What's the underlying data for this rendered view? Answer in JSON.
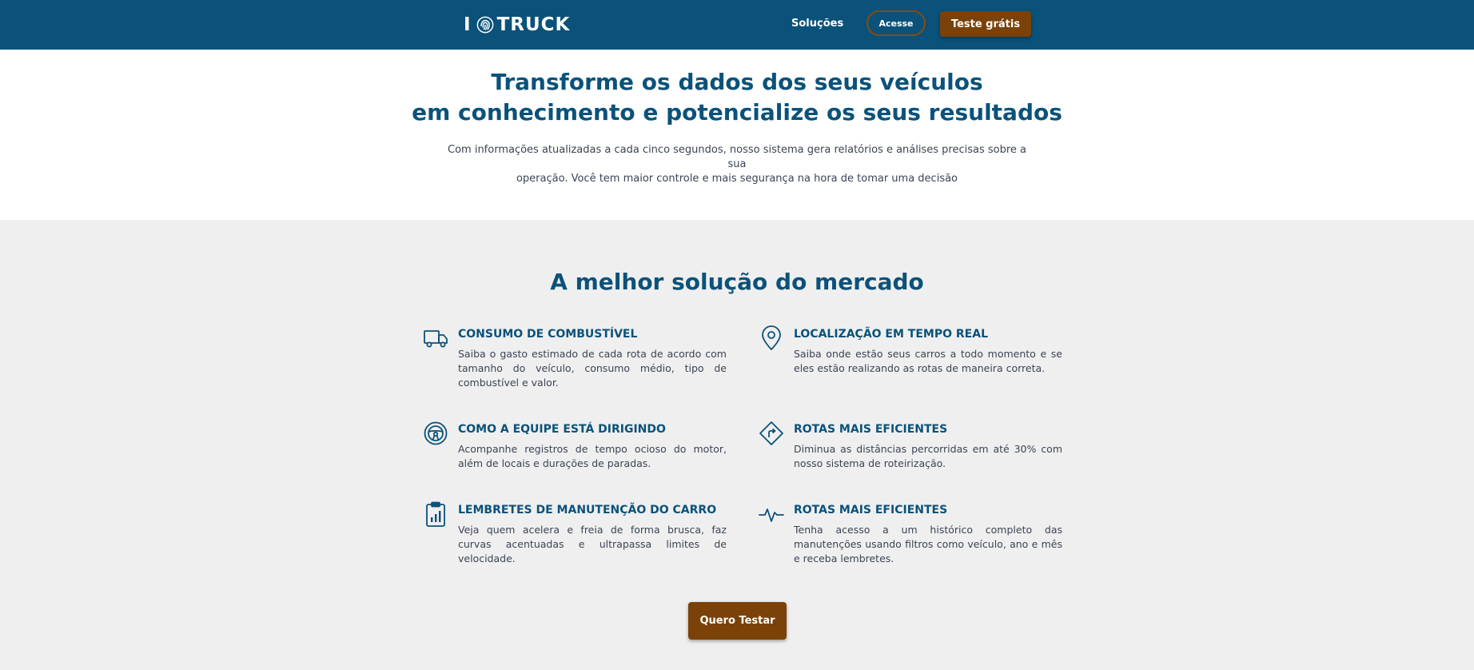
{
  "header": {
    "logo_left": "I",
    "logo_right": "TRUCK",
    "nav_solucoes": "Soluções",
    "nav_acesse": "Acesse",
    "nav_teste": "Teste grátis"
  },
  "hero": {
    "title_line1": "Transforme os dados dos seus veículos",
    "title_line2": "em conhecimento e potencialize os seus resultados",
    "desc_line1": "Com informações atualizadas a cada cinco segundos, nosso sistema gera relatórios e análises precisas sobre a sua",
    "desc_line2": "operação. Você tem maior controle e mais segurança na hora de tomar uma decisão"
  },
  "solutions": {
    "title": "A melhor solução do mercado",
    "features": [
      {
        "icon": "truck-icon",
        "title": "CONSUMO DE COMBUSTÍVEL",
        "desc": "Saiba o gasto estimado de cada rota de acordo com tamanho do veículo, consumo médio, tipo de combustível e valor."
      },
      {
        "icon": "location-pin-icon",
        "title": "LOCALIZAÇÃO EM TEMPO REAL",
        "desc": "Saiba onde estão seus carros a todo momento e se eles estão realizando as rotas de maneira correta."
      },
      {
        "icon": "steering-wheel-icon",
        "title": "COMO A EQUIPE ESTÁ DIRIGINDO",
        "desc": "Acompanhe registros de tempo ocioso do motor, além de locais e durações de paradas."
      },
      {
        "icon": "route-sign-icon",
        "title": "ROTAS MAIS EFICIENTES",
        "desc": "Diminua as distâncias percorridas em até 30% com nosso sistema de roteirização."
      },
      {
        "icon": "clipboard-chart-icon",
        "title": "LEMBRETES DE MANUTENÇÃO DO CARRO",
        "desc": "Veja quem acelera e freia de forma brusca, faz curvas acentuadas e ultrapassa limites de velocidade."
      },
      {
        "icon": "pulse-icon",
        "title": "ROTAS MAIS EFICIENTES",
        "desc": "Tenha acesso a um histórico completo das manutenções usando filtros como veículo, ano e mês e receba lembretes."
      }
    ],
    "cta": "Quero Testar"
  },
  "colors": {
    "primary_blue": "#0a527a",
    "accent_brown": "#7a4209",
    "section_bg": "#efefef",
    "body_text": "#3b4454"
  }
}
